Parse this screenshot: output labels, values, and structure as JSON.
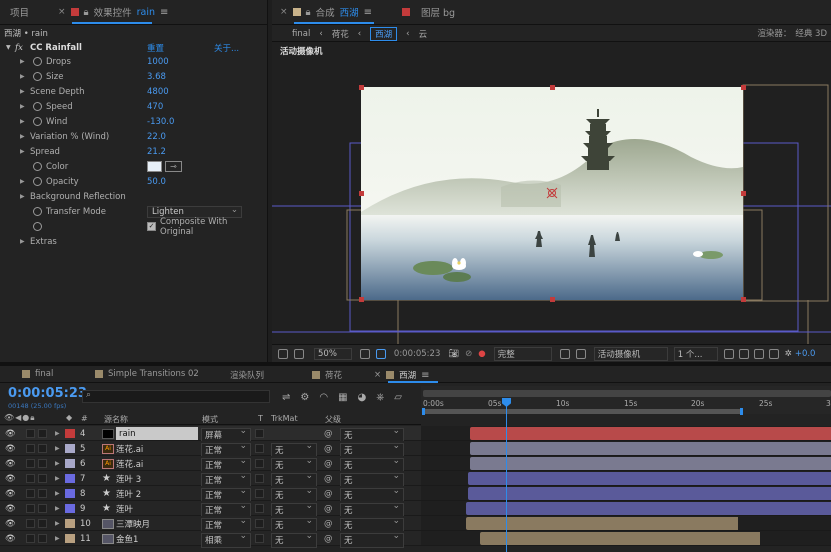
{
  "left_panel": {
    "tab_project": "项目",
    "tab_effects": "效果控件",
    "tab_effects_layer": "rain",
    "breadcrumb": "西湖 • rain",
    "effect_name": "CC Rainfall",
    "reset_label": "重置",
    "about_label": "关于...",
    "params": [
      {
        "label": "Drops",
        "value": "1000"
      },
      {
        "label": "Size",
        "value": "3.68"
      },
      {
        "label": "Scene Depth",
        "value": "4800"
      },
      {
        "label": "Speed",
        "value": "470"
      },
      {
        "label": "Wind",
        "value": "-130.0"
      },
      {
        "label": "Variation % (Wind)",
        "value": "22.0"
      },
      {
        "label": "Spread",
        "value": "21.2"
      },
      {
        "label": "Color",
        "value": ""
      },
      {
        "label": "Opacity",
        "value": "50.0"
      },
      {
        "label": "Background Reflection",
        "value": ""
      },
      {
        "label": "Transfer Mode",
        "value": "Lighten"
      },
      {
        "label": "",
        "value": "Composite With Original"
      },
      {
        "label": "Extras",
        "value": ""
      }
    ],
    "color_swatch": "#e8f0f8"
  },
  "comp_panel": {
    "tab_comp_prefix": "合成",
    "tab_comp_name": "西湖",
    "tab_layer": "图层 bg",
    "crumbs": [
      "final",
      "荷花",
      "西湖",
      "云"
    ],
    "renderer_label": "渲染器：",
    "renderer_value": "经典 3D",
    "camera_label": "活动摄像机",
    "zoom": "50%",
    "timecode": "0:00:05:23",
    "quality": "完整",
    "view_camera": "活动摄像机",
    "views": "1 个...",
    "exposure": "+0.0"
  },
  "timeline": {
    "tabs": [
      "final",
      "Simple Transitions 02",
      "渲染队列",
      "荷花",
      "西湖"
    ],
    "timecode": "0:00:05:23",
    "frame_info": "00148 (25.00 fps)",
    "search_placeholder": "",
    "ruler": [
      "0:00s",
      "05s",
      "10s",
      "15s",
      "20s",
      "25s",
      "3"
    ],
    "col_hash": "#",
    "col_source": "源名称",
    "col_mode": "模式",
    "col_t": "T",
    "col_trkmat": "TrkMat",
    "col_parent": "父级",
    "layers": [
      {
        "num": "4",
        "name": "rain",
        "mode": "屏幕",
        "trkmat": "",
        "parent": "无",
        "label": "#c33b3b",
        "icon": "solid",
        "bar": "#b84a4a"
      },
      {
        "num": "5",
        "name": "莲花.ai",
        "mode": "正常",
        "trkmat": "无",
        "parent": "无",
        "label": "#a8a8c8",
        "icon": "ai",
        "bar": "#7a7a90"
      },
      {
        "num": "6",
        "name": "莲花.ai",
        "mode": "正常",
        "trkmat": "无",
        "parent": "无",
        "label": "#a8a8c8",
        "icon": "ai",
        "bar": "#7a7a90"
      },
      {
        "num": "7",
        "name": "莲叶 3",
        "mode": "正常",
        "trkmat": "无",
        "parent": "无",
        "label": "#6a6ae0",
        "icon": "star",
        "bar": "#5a5a9a"
      },
      {
        "num": "8",
        "name": "莲叶 2",
        "mode": "正常",
        "trkmat": "无",
        "parent": "无",
        "label": "#6a6ae0",
        "icon": "star",
        "bar": "#5a5a9a"
      },
      {
        "num": "9",
        "name": "莲叶",
        "mode": "正常",
        "trkmat": "无",
        "parent": "无",
        "label": "#6a6ae0",
        "icon": "star",
        "bar": "#5a5a9a"
      },
      {
        "num": "10",
        "name": "三潭映月",
        "mode": "正常",
        "trkmat": "无",
        "parent": "无",
        "label": "#b8a080",
        "icon": "img",
        "bar": "#8a7a60"
      },
      {
        "num": "11",
        "name": "金鱼1",
        "mode": "相乘",
        "trkmat": "无",
        "parent": "无",
        "label": "#b8a080",
        "icon": "img",
        "bar": "#8a7a60"
      }
    ]
  }
}
